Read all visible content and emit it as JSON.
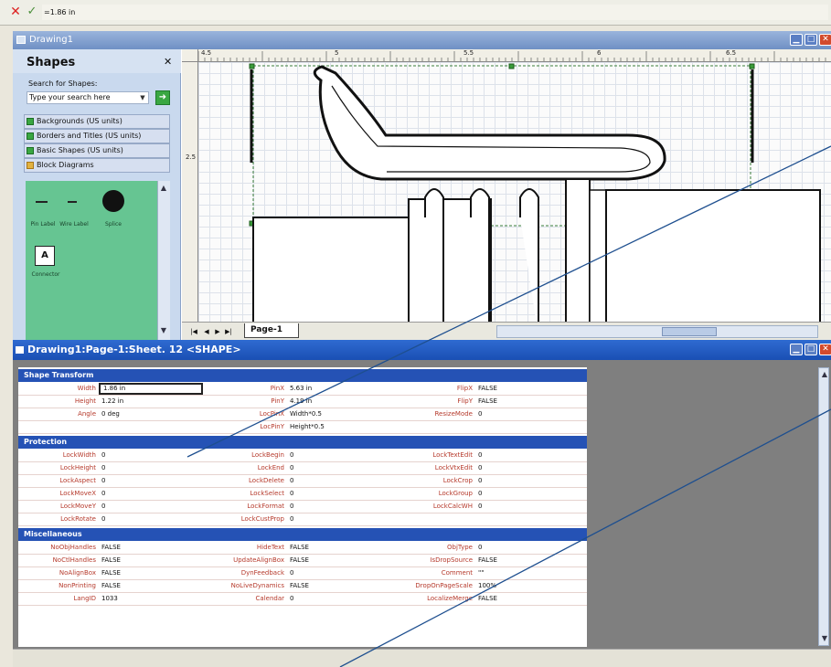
{
  "formula_bar": {
    "cancel_glyph": "✕",
    "enter_glyph": "✓",
    "value": "=1.86 in"
  },
  "drawing_window": {
    "title": "Drawing1",
    "buttons": {
      "minimize": "▁",
      "maximize": "□",
      "close": "✕"
    },
    "ruler_labels": [
      "4.5",
      "5",
      "5.5",
      "6",
      "6.5"
    ],
    "ruler_left_label": "2.5",
    "page_tab": "Page-1",
    "tab_nav": [
      "|◀",
      "◀",
      "▶",
      "▶|"
    ]
  },
  "shapes_panel": {
    "title": "Shapes",
    "close": "✕",
    "search_label": "Search for Shapes:",
    "search_placeholder": "Type your search here",
    "stencils": [
      "Backgrounds (US units)",
      "Borders and Titles (US units)",
      "Basic Shapes (US units)",
      "Block Diagrams"
    ],
    "masters": {
      "pin_label": "Pin Label",
      "wire_label": "Wire Label",
      "splice": "Splice",
      "connector": "Connector",
      "connector_letter": "A"
    }
  },
  "shapesheet": {
    "title": "Drawing1:Page-1:Sheet. 12 <SHAPE>",
    "sections": {
      "transform": {
        "header": "Shape Transform",
        "rows": [
          [
            [
              "Width",
              "1.86 in"
            ],
            [
              "PinX",
              "5.63 in"
            ],
            [
              "FlipX",
              "FALSE"
            ]
          ],
          [
            [
              "Height",
              "1.22 in"
            ],
            [
              "PinY",
              "4.19 in"
            ],
            [
              "FlipY",
              "FALSE"
            ]
          ],
          [
            [
              "Angle",
              "0 deg"
            ],
            [
              "LocPinX",
              "Width*0.5"
            ],
            [
              "ResizeMode",
              "0"
            ]
          ],
          [
            [
              "",
              ""
            ],
            [
              "LocPinY",
              "Height*0.5"
            ],
            [
              "",
              ""
            ]
          ]
        ]
      },
      "protection": {
        "header": "Protection",
        "rows": [
          [
            [
              "LockWidth",
              "0"
            ],
            [
              "LockBegin",
              "0"
            ],
            [
              "LockTextEdit",
              "0"
            ]
          ],
          [
            [
              "LockHeight",
              "0"
            ],
            [
              "LockEnd",
              "0"
            ],
            [
              "LockVtxEdit",
              "0"
            ]
          ],
          [
            [
              "LockAspect",
              "0"
            ],
            [
              "LockDelete",
              "0"
            ],
            [
              "LockCrop",
              "0"
            ]
          ],
          [
            [
              "LockMoveX",
              "0"
            ],
            [
              "LockSelect",
              "0"
            ],
            [
              "LockGroup",
              "0"
            ]
          ],
          [
            [
              "LockMoveY",
              "0"
            ],
            [
              "LockFormat",
              "0"
            ],
            [
              "LockCalcWH",
              "0"
            ]
          ],
          [
            [
              "LockRotate",
              "0"
            ],
            [
              "LockCustProp",
              "0"
            ],
            [
              "",
              ""
            ]
          ]
        ]
      },
      "misc": {
        "header": "Miscellaneous",
        "rows": [
          [
            [
              "NoObjHandles",
              "FALSE"
            ],
            [
              "HideText",
              "FALSE"
            ],
            [
              "ObjType",
              "0"
            ]
          ],
          [
            [
              "NoCtlHandles",
              "FALSE"
            ],
            [
              "UpdateAlignBox",
              "FALSE"
            ],
            [
              "IsDropSource",
              "FALSE"
            ]
          ],
          [
            [
              "NoAlignBox",
              "FALSE"
            ],
            [
              "DynFeedback",
              "0"
            ],
            [
              "Comment",
              "\"\""
            ]
          ],
          [
            [
              "NonPrinting",
              "FALSE"
            ],
            [
              "NoLiveDynamics",
              "FALSE"
            ],
            [
              "DropOnPageScale",
              "100%"
            ]
          ],
          [
            [
              "LangID",
              "1033"
            ],
            [
              "Calendar",
              "0"
            ],
            [
              "LocalizeMerge",
              "FALSE"
            ]
          ]
        ]
      }
    }
  },
  "colors": {
    "section_header": "#2552b5",
    "cell_name": "#b63a2c",
    "stencil_bg": "#66c592",
    "title_bar": "#1a4fb4"
  }
}
